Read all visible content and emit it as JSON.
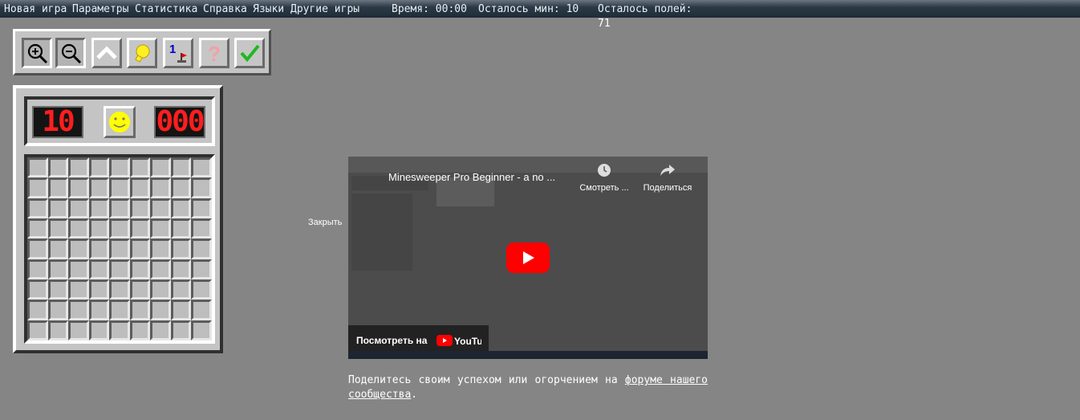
{
  "menu": {
    "items": [
      "Новая игра",
      "Параметры",
      "Статистика",
      "Справка",
      "Языки",
      "Другие игры"
    ],
    "time_label": "Время: 00:00",
    "mines_left_label": "Осталось мин: 10",
    "fields_left_label": "Осталось полей:",
    "fields_left_value": "71"
  },
  "toolbar": {
    "buttons": [
      "zoom-in-icon",
      "zoom-out-icon",
      "up-arrow-icon",
      "hint-bulb-icon",
      "number-flag-icon",
      "question-mark-icon",
      "checkmark-icon"
    ]
  },
  "game": {
    "mines_counter": "10",
    "timer": "000",
    "smiley": "smiley-face-icon",
    "rows": 9,
    "cols": 9
  },
  "embed": {
    "close_label": "Закрыть",
    "video_title": "Minesweeper Pro Beginner - a no ...",
    "watch_later": "Смотреть ...",
    "share": "Поделиться",
    "watch_on": "Посмотреть на",
    "youtube": "YouTube"
  },
  "footer": {
    "text_before": "Поделитесь своим успехом или огорчением на ",
    "link_text": "форуме нашего сообщества",
    "text_after": "."
  },
  "colors": {
    "background": "#858585",
    "led_red": "#ff1e1e",
    "smiley_yellow": "#ffff00",
    "youtube_red": "#ff0000"
  }
}
